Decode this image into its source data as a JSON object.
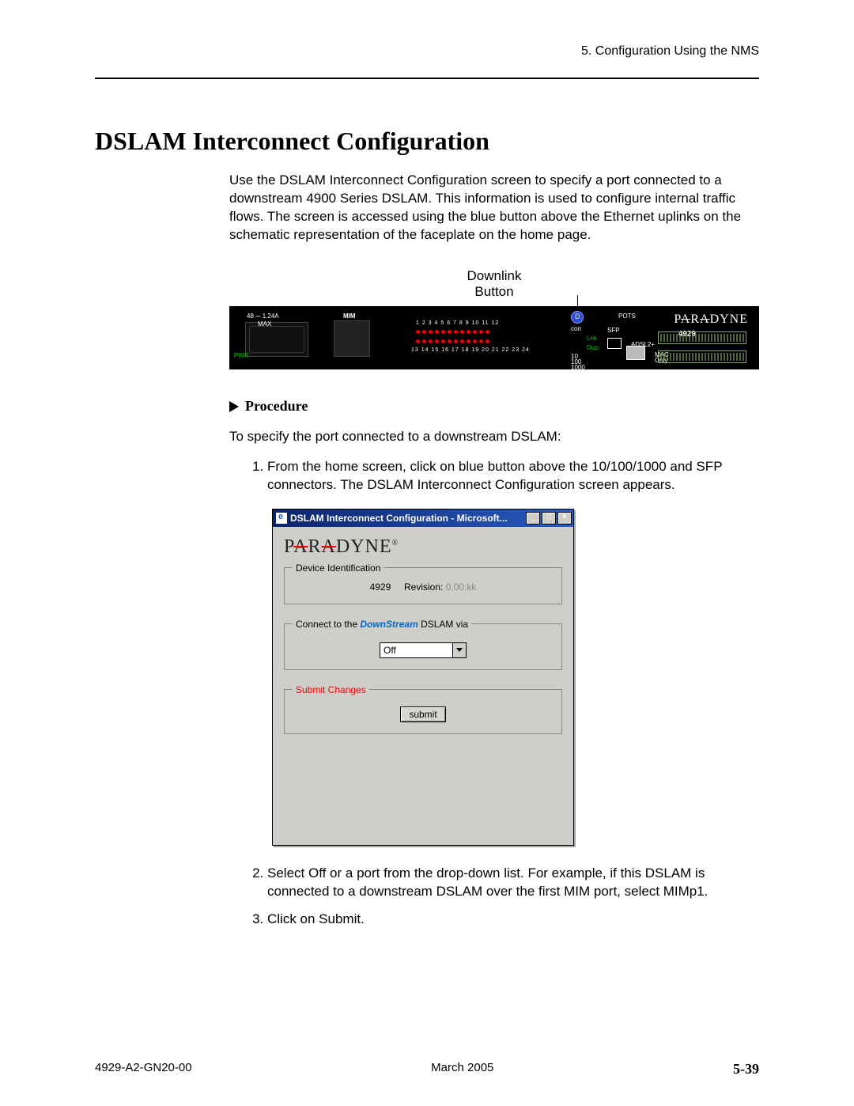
{
  "header": {
    "chapter": "5. Configuration Using the NMS"
  },
  "title": "DSLAM Interconnect Configuration",
  "intro": "Use the DSLAM Interconnect Configuration screen to specify a port connected to a downstream 4900 Series DSLAM. This information is used to configure internal traffic flows. The screen is accessed using the blue button above the Ethernet uplinks on the schematic representation of the faceplate on the home page.",
  "downlink_label_line1": "Downlink",
  "downlink_label_line2": "Button",
  "faceplate": {
    "brand": "PARADYNE",
    "model": "4929",
    "mim": "MIM",
    "pwr": "PWR",
    "max": "MAX",
    "amps": "48 ⎓ 1.24A",
    "con": "con",
    "lnk": "Lnk",
    "dup": "Dup",
    "sfp": "SFP",
    "pots": "POTS",
    "adsl": "ADSL2+",
    "rate": "10\n100\n1000",
    "mac": "MAC\nOnly",
    "nums_top": "1  2  3  4  5  6  7  8  9 10 11 12",
    "nums_bot": "13 14 15 16 17 18 19 20 21 22 23 24"
  },
  "procedure_heading": "Procedure",
  "procedure_intro": "To specify the port connected to a downstream DSLAM:",
  "steps": {
    "s1": "From the home screen, click on blue button above the 10/100/1000 and SFP connectors. The DSLAM Interconnect Configuration screen appears.",
    "s2": "Select Off or a port from the drop-down list. For example, if this DSLAM is connected to a downstream DSLAM over the first MIM port, select MIMp1.",
    "s3": "Click on Submit."
  },
  "dialog": {
    "title": "DSLAM Interconnect Configuration - Microsoft...",
    "brand": "PARADYNE",
    "devid_legend": "Device Identification",
    "device_model": "4929",
    "revision_label": "Revision:",
    "revision_value": "0.00.kk",
    "connect_legend_pre": "Connect to the ",
    "connect_legend_em": "DownStream",
    "connect_legend_post": " DSLAM via",
    "select_value": "Off",
    "submit_legend": "Submit Changes",
    "submit_label": "submit",
    "min": "_",
    "max": "□",
    "close": "×"
  },
  "footer": {
    "doc": "4929-A2-GN20-00",
    "date": "March 2005",
    "page": "5-39"
  }
}
